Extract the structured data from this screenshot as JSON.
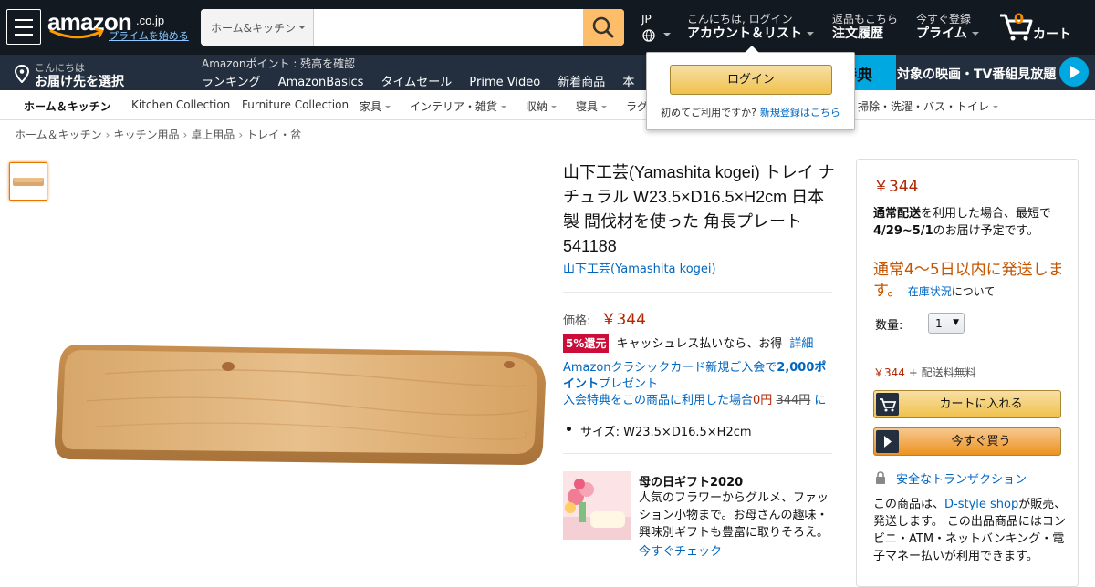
{
  "header": {
    "logo": {
      "word": "amazon",
      "tld": ".co.jp",
      "prime_link": "プライムを始める"
    },
    "search": {
      "category": "ホーム&キッチン",
      "value": "",
      "placeholder": ""
    },
    "lang": {
      "code": "JP"
    },
    "account": {
      "greeting": "こんにちは, ログイン",
      "label": "アカウント＆リスト"
    },
    "orders": {
      "line1": "返品もこちら",
      "line2": "注文履歴"
    },
    "prime": {
      "line1": "今すぐ登録",
      "line2": "プライム"
    },
    "cart": {
      "count": "0",
      "label": "カート"
    }
  },
  "nav": {
    "deliver_line1": "こんにちは",
    "deliver_line2": "お届け先を選択",
    "points": "Amazonポイント : 残高を確認",
    "links": [
      "ランキング",
      "AmazonBasics",
      "タイムセール",
      "Prime Video",
      "新着商品",
      "本"
    ],
    "promo_tag": "特典",
    "promo_text": "対象の映画・TV番組見放題"
  },
  "subnav": [
    "ホーム＆キッチン",
    "Kitchen Collection",
    "Furniture Collection",
    "家具",
    "インテリア・雑貨",
    "収納",
    "寝具",
    "ラグ",
    "掃除・洗濯・バス・トイレ"
  ],
  "flyout": {
    "signin_label": "ログイン",
    "new_customer": "初めてご利用ですか?",
    "register_link": "新規登録はこちら"
  },
  "breadcrumb": [
    "ホーム＆キッチン",
    "キッチン用品",
    "卓上用品",
    "トレイ・盆"
  ],
  "product": {
    "title": "山下工芸(Yamashita kogei) トレイ ナチュラル W23.5×D16.5×H2cm 日本製 間伐材を使った 角長プレート 541188",
    "brand": "山下工芸(Yamashita kogei)",
    "price_label": "価格:",
    "price": "￥344",
    "cashback_badge": "5%還元",
    "cashback_text": "キャッシュレス払いなら、お得",
    "cashback_link": "詳細",
    "card_line1a": "Amazonクラシックカード新規ご入会で",
    "card_line1b": "2,000ポイント",
    "card_line1c": "プレゼント",
    "card_line2a": "入会特典をこの商品に利用した場合",
    "card_line2b": "0円",
    "card_line2c": "344円",
    "card_line2d": "に",
    "size": "サイズ: W23.5×D16.5×H2cm"
  },
  "gift": {
    "title": "母の日ギフト2020",
    "desc": "人気のフラワーからグルメ、ファッション小物まで。お母さんの趣味・興味別ギフトも豊富に取りそろえ。",
    "link": "今すぐチェック"
  },
  "buybox": {
    "price": "￥344",
    "ship_bold": "通常配送",
    "ship_text": "を利用した場合、最短で",
    "ship_date": "4/29~5/1",
    "ship_tail": "のお届け予定です。",
    "stock": "通常4～5日以内に発送します。",
    "stock_link": "在庫状況",
    "stock_tail": "について",
    "qty_label": "数量:",
    "qty_value": "1",
    "total_price": "￥344",
    "total_tail": "+ 配送料無料",
    "cart_btn": "カートに入れる",
    "buy_btn": "今すぐ買う",
    "secure": "安全なトランザクション",
    "seller_pre": "この商品は、",
    "seller_link": "D-style shop",
    "seller_post": "が販売、発送します。 この出品商品にはコンビニ・ATM・ネットバンキング・電子マネー払いが利用できます。"
  },
  "colors": {
    "nav_dark": "#131921",
    "nav_mid": "#232f3e",
    "search_button": "#febd69",
    "price_red": "#b12704",
    "link_blue": "#0066c0",
    "stock_orange": "#c45500",
    "prime_blue": "#00a8e1"
  },
  "icons": [
    "hamburger-icon",
    "search-icon",
    "globe-icon",
    "cart-icon",
    "location-pin-icon",
    "play-icon",
    "lock-icon"
  ]
}
